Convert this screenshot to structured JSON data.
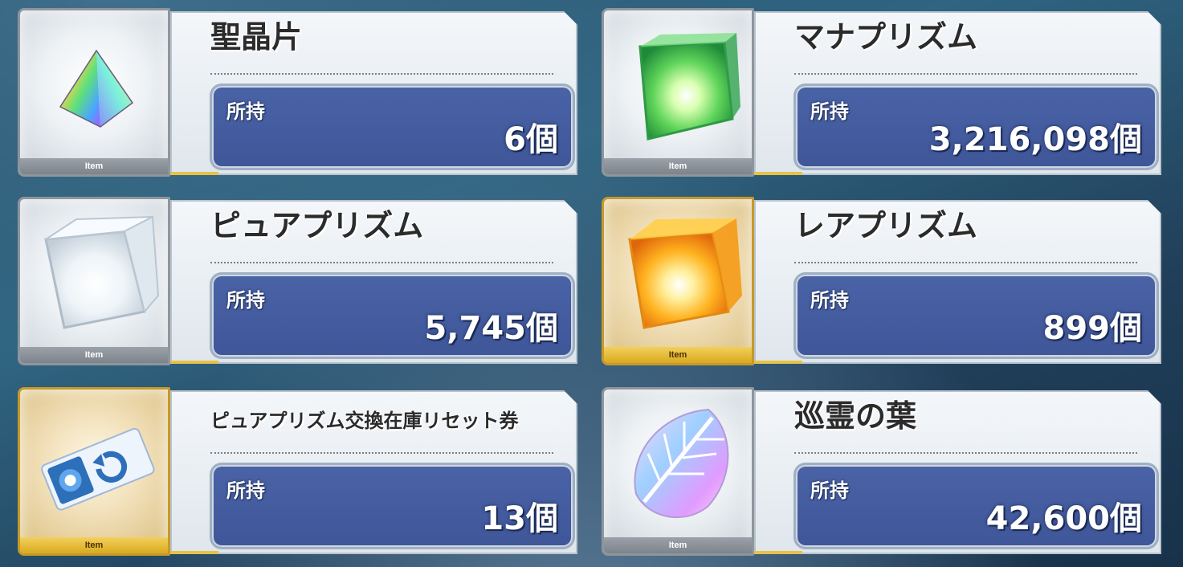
{
  "items": [
    {
      "name": "聖晶片",
      "owned_label": "所持",
      "owned_value": "6個",
      "tag": "Item",
      "icon": "rainbow-pyramid-icon"
    },
    {
      "name": "マナプリズム",
      "owned_label": "所持",
      "owned_value": "3,216,098個",
      "tag": "Item",
      "icon": "green-prism-icon"
    },
    {
      "name": "ピュアプリズム",
      "owned_label": "所持",
      "owned_value": "5,745個",
      "tag": "Item",
      "icon": "white-prism-icon"
    },
    {
      "name": "レアプリズム",
      "owned_label": "所持",
      "owned_value": "899個",
      "tag": "Item",
      "icon": "gold-prism-icon"
    },
    {
      "name": "ピュアプリズム交換在庫リセット券",
      "owned_label": "所持",
      "owned_value": "13個",
      "tag": "Item",
      "icon": "reset-ticket-icon"
    },
    {
      "name": "巡霊の葉",
      "owned_label": "所持",
      "owned_value": "42,600個",
      "tag": "Item",
      "icon": "spirit-leaf-icon"
    }
  ]
}
